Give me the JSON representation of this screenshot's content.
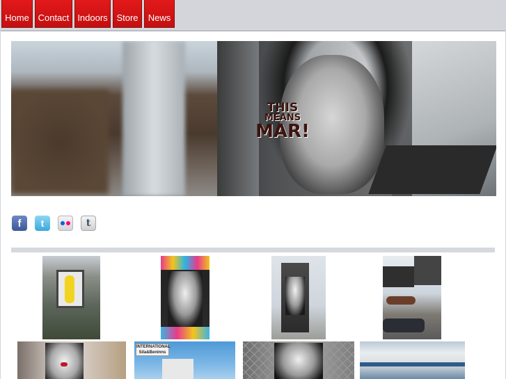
{
  "nav": {
    "items": [
      {
        "label": "Home"
      },
      {
        "label": "Contact"
      },
      {
        "label": "Indoors"
      },
      {
        "label": "Store"
      },
      {
        "label": "News"
      }
    ]
  },
  "hero": {
    "caption_line1": "THIS",
    "caption_line2": "MEANS",
    "caption_line3": "MAR!"
  },
  "social": {
    "icons": [
      {
        "name": "facebook-icon",
        "glyph": "f"
      },
      {
        "name": "twitter-icon",
        "glyph": "t"
      },
      {
        "name": "flickr-icon",
        "glyph": ""
      },
      {
        "name": "tumblr-icon",
        "glyph": "t"
      }
    ]
  },
  "gallery": {
    "row2_sign_text_line1": "INTERNATIONAL",
    "row2_sign_text_line2": "Sila&Beninns"
  },
  "colors": {
    "nav_red": "#d11415",
    "page_bg": "#d3d5da",
    "panel_bg": "#ffffff",
    "divider": "#d5d8dd",
    "flickr_blue": "#0063dc",
    "flickr_pink": "#ff0084"
  }
}
